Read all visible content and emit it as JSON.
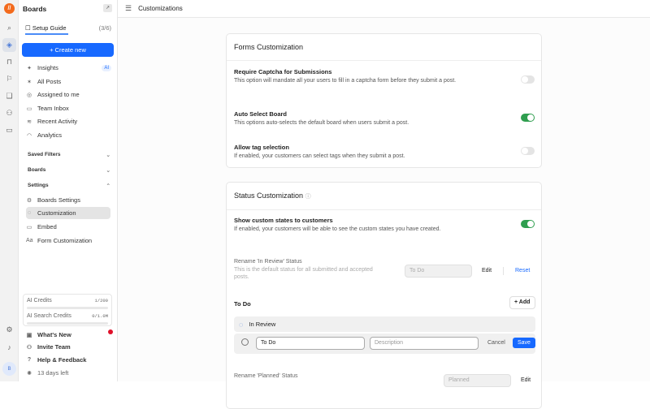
{
  "rail": {
    "logo": "logo",
    "user_initial": "B"
  },
  "sidebar": {
    "title": "Boards",
    "guide": {
      "label": "Setup Guide",
      "count": "(3/6)"
    },
    "create": "+ Create new",
    "items": [
      {
        "label": "Insights",
        "icon": "✦",
        "badge": "AI"
      },
      {
        "label": "All Posts",
        "icon": "✶"
      },
      {
        "label": "Assigned to me",
        "icon": "◎"
      },
      {
        "label": "Team Inbox",
        "icon": "▭"
      },
      {
        "label": "Recent Activity",
        "icon": "≋"
      },
      {
        "label": "Analytics",
        "icon": "◠"
      }
    ],
    "sections": {
      "saved": "Saved Filters",
      "boards": "Boards",
      "settings": "Settings"
    },
    "settings_items": [
      {
        "label": "Boards Settings",
        "icon": "⚙"
      },
      {
        "label": "Customization",
        "icon": "◌"
      },
      {
        "label": "Embed",
        "icon": "▭"
      },
      {
        "label": "Form Customization",
        "icon": "Aa"
      }
    ],
    "credits": [
      {
        "label": "AI Credits",
        "value": "1/200",
        "fraction": 0.005
      },
      {
        "label": "AI Search Credits",
        "value": "0/1.0M",
        "fraction": 0
      }
    ],
    "bottom": [
      {
        "label": "What's New",
        "icon": "▣"
      },
      {
        "label": "Invite Team",
        "icon": "⚇"
      },
      {
        "label": "Help & Feedback",
        "icon": "?"
      },
      {
        "label": "13 days left",
        "icon": "✺"
      }
    ]
  },
  "header": {
    "title": "Customizations"
  },
  "forms": {
    "title": "Forms Customization",
    "rows": [
      {
        "title": "Require Captcha for Submissions",
        "desc": "This option will mandate all your users to fill in a captcha form before they submit a post.",
        "on": false
      },
      {
        "title": "Auto Select Board",
        "desc": "This options auto-selects the default board when users submit a post.",
        "on": true
      },
      {
        "title": "Allow tag selection",
        "desc": "If enabled, your customers can select tags when they submit a post.",
        "on": false
      }
    ]
  },
  "status": {
    "title": "Status Customization",
    "show": {
      "title": "Show custom states to customers",
      "desc": "If enabled, your customers will be able to see the custom states you have created.",
      "on": true
    },
    "in_review": {
      "title": "Rename 'In Review' Status",
      "desc": "This is the default status for all submitted and accepted posts.",
      "placeholder": "To Do",
      "edit": "Edit",
      "reset": "Reset"
    },
    "todo": {
      "title": "To Do",
      "add": "+ Add",
      "existing": "In Review",
      "name_value": "To Do",
      "desc_placeholder": "Description",
      "cancel": "Cancel",
      "save": "Save"
    },
    "planned": {
      "title": "Rename 'Planned' Status",
      "placeholder": "Planned",
      "edit": "Edit"
    }
  }
}
